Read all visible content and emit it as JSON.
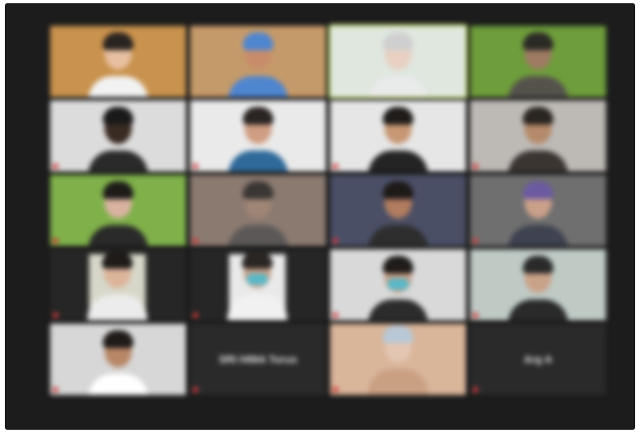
{
  "meeting": {
    "participants": [
      {
        "row": 1,
        "col": 1,
        "name": "",
        "video": true,
        "muted": false,
        "bg": "#c9924e",
        "skin": "#e7c0a0",
        "shirt": "#f2f2f2",
        "hair": "#2a2420"
      },
      {
        "row": 1,
        "col": 2,
        "name": "",
        "video": true,
        "muted": false,
        "bg": "#c59a6a",
        "skin": "#c88c6a",
        "shirt": "#4f86d0",
        "hair": "#4f86d0"
      },
      {
        "row": 1,
        "col": 3,
        "name": "",
        "video": true,
        "muted": false,
        "active": true,
        "bg": "#dfe7df",
        "skin": "#e8d0c2",
        "shirt": "#e9eaea",
        "hair": "#cfcfcf"
      },
      {
        "row": 1,
        "col": 4,
        "name": "",
        "video": true,
        "muted": false,
        "bg": "#6e9d3b",
        "skin": "#9e7b62",
        "shirt": "#55524c",
        "hair": "#2c2a26"
      },
      {
        "row": 2,
        "col": 1,
        "name": "",
        "video": true,
        "muted": true,
        "bg": "#dcdcdc",
        "skin": "#3a2b22",
        "shirt": "#2a2a2a",
        "hair": "#1a1a1a"
      },
      {
        "row": 2,
        "col": 2,
        "name": "",
        "video": true,
        "muted": true,
        "bg": "#eaeaea",
        "skin": "#cf9d82",
        "shirt": "#2f6a9a",
        "hair": "#2a2422"
      },
      {
        "row": 2,
        "col": 3,
        "name": "",
        "video": true,
        "muted": true,
        "bg": "#e6e6e6",
        "skin": "#c79774",
        "shirt": "#242424",
        "hair": "#1f1c1a"
      },
      {
        "row": 2,
        "col": 4,
        "name": "",
        "video": true,
        "muted": true,
        "bg": "#bdb9b5",
        "skin": "#b58a6a",
        "shirt": "#3b3532",
        "hair": "#2a2520"
      },
      {
        "row": 3,
        "col": 1,
        "name": "",
        "video": true,
        "muted": true,
        "bg": "#7fb04a",
        "skin": "#d9b3a0",
        "shirt": "#2a2a2a",
        "hair": "#1e1b19"
      },
      {
        "row": 3,
        "col": 2,
        "name": "",
        "video": true,
        "muted": true,
        "bg": "#8b7a70",
        "skin": "#9f8575",
        "shirt": "#5c5858",
        "hair": "#3a3634"
      },
      {
        "row": 3,
        "col": 3,
        "name": "",
        "video": true,
        "muted": true,
        "bg": "#4b4f66",
        "skin": "#b17c5f",
        "shirt": "#2e2e2e",
        "hair": "#1e1a18"
      },
      {
        "row": 3,
        "col": 4,
        "name": "",
        "video": true,
        "muted": true,
        "bg": "#6f6f6f",
        "skin": "#caa08a",
        "shirt": "#3f4250",
        "hair": "#6b5aa0"
      },
      {
        "row": 4,
        "col": 1,
        "name": "",
        "video": true,
        "muted": true,
        "inset": true,
        "bg": "#d7d7c9",
        "skin": "#dcb49a",
        "shirt": "#ececec",
        "hair": "#1e1b19"
      },
      {
        "row": 4,
        "col": 2,
        "name": "",
        "video": true,
        "muted": true,
        "inset": true,
        "bg": "#e9e9e9",
        "skin": "#caa088",
        "shirt": "#f1f1f1",
        "hair": "#2a2624",
        "mask": true
      },
      {
        "row": 4,
        "col": 3,
        "name": "",
        "video": true,
        "muted": true,
        "bg": "#d9d9d9",
        "skin": "#c89f86",
        "shirt": "#2c2c2c",
        "hair": "#1f1c1a",
        "mask": true
      },
      {
        "row": 4,
        "col": 4,
        "name": "",
        "video": true,
        "muted": true,
        "bg": "#bfcac5",
        "skin": "#caa28a",
        "shirt": "#2a2a2a",
        "hair": "#2a2a2a"
      },
      {
        "row": 5,
        "col": 1,
        "name": "",
        "video": true,
        "muted": true,
        "bg": "#d7d7d7",
        "skin": "#b88768",
        "shirt": "#ffffff",
        "hair": "#1f1b19"
      },
      {
        "row": 5,
        "col": 2,
        "name": "SRI HIMA Torus",
        "video": false,
        "muted": true
      },
      {
        "row": 5,
        "col": 3,
        "name": "",
        "video": true,
        "muted": true,
        "avatar": true,
        "bg": "#d9b59a",
        "skin": "#e3c6b2",
        "shirt": "#caa082",
        "hair": "#b8c8d6"
      },
      {
        "row": 5,
        "col": 4,
        "name": "Arg A",
        "video": false,
        "muted": true
      }
    ]
  }
}
